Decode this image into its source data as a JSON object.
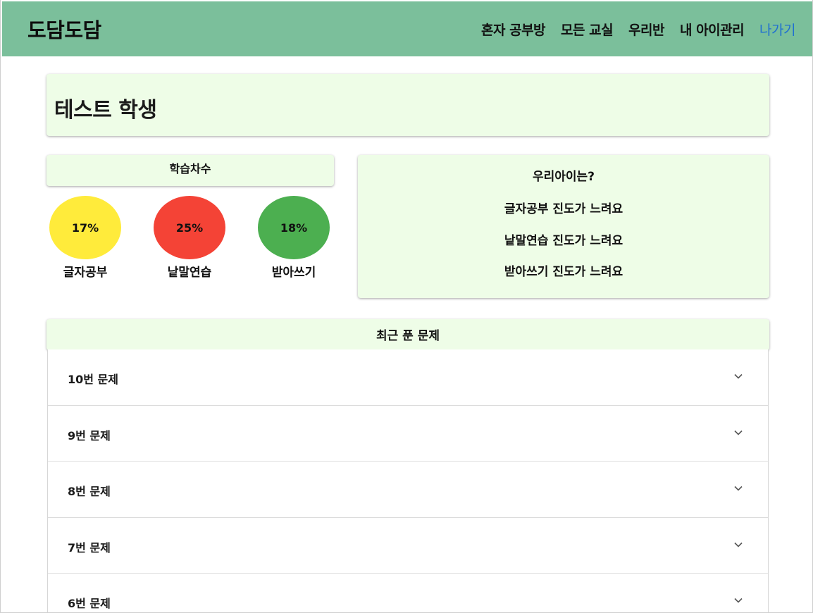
{
  "header": {
    "brand": "도담도담",
    "nav": [
      "혼자 공부방",
      "모든 교실",
      "우리반",
      "내 아이관리",
      "나가기"
    ]
  },
  "student": {
    "name": "테스트 학생"
  },
  "progress": {
    "title": "학습차수",
    "items": [
      {
        "label": "글자공부",
        "percent": "17%",
        "color": "#ffeb3b"
      },
      {
        "label": "낱말연습",
        "percent": "25%",
        "color": "#f44336"
      },
      {
        "label": "받아쓰기",
        "percent": "18%",
        "color": "#4caf50"
      }
    ]
  },
  "feedback": {
    "title": "우리아이는?",
    "lines": [
      "글자공부 진도가 느려요",
      "낱말연습 진도가 느려요",
      "받아쓰기 진도가 느려요"
    ]
  },
  "recent": {
    "title": "최근 푼 문제",
    "items": [
      "10번 문제",
      "9번 문제",
      "8번 문제",
      "7번 문제",
      "6번 문제"
    ]
  },
  "icons": {
    "accordion_toggle": "chevron-down-icon"
  }
}
